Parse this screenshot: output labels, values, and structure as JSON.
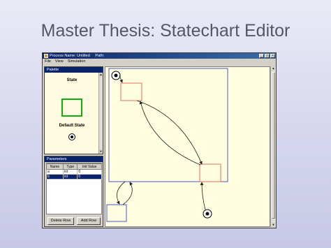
{
  "slide": {
    "title": "Master Thesis: Statechart Editor"
  },
  "window": {
    "title": "Process Name: Untitled     Path:",
    "buttons": [
      "_",
      "□",
      "×"
    ]
  },
  "menu": [
    "File",
    "View",
    "Simulation"
  ],
  "palette": {
    "header": "Palette",
    "state_label": "State",
    "default_state_label": "Default State"
  },
  "parameters": {
    "header": "Parameters",
    "columns": [
      "Name",
      "Type",
      "Init Value"
    ],
    "rows": [
      [
        "a",
        "int",
        "0"
      ],
      [
        "b",
        "int",
        "0"
      ]
    ],
    "selected_row": 1,
    "delete_button": "Delete Row",
    "add_button": "Add Row"
  },
  "colors": {
    "state_border": "#e07060",
    "palette_state_border": "#11aa11",
    "composite_border": "#4a56c8",
    "selection_highlight": "#0a246a"
  },
  "icons": [
    "app-icon",
    "minimize-icon",
    "maximize-icon",
    "close-icon",
    "scroll-up-arrow-icon",
    "scroll-down-arrow-icon",
    "default-state-icon"
  ]
}
